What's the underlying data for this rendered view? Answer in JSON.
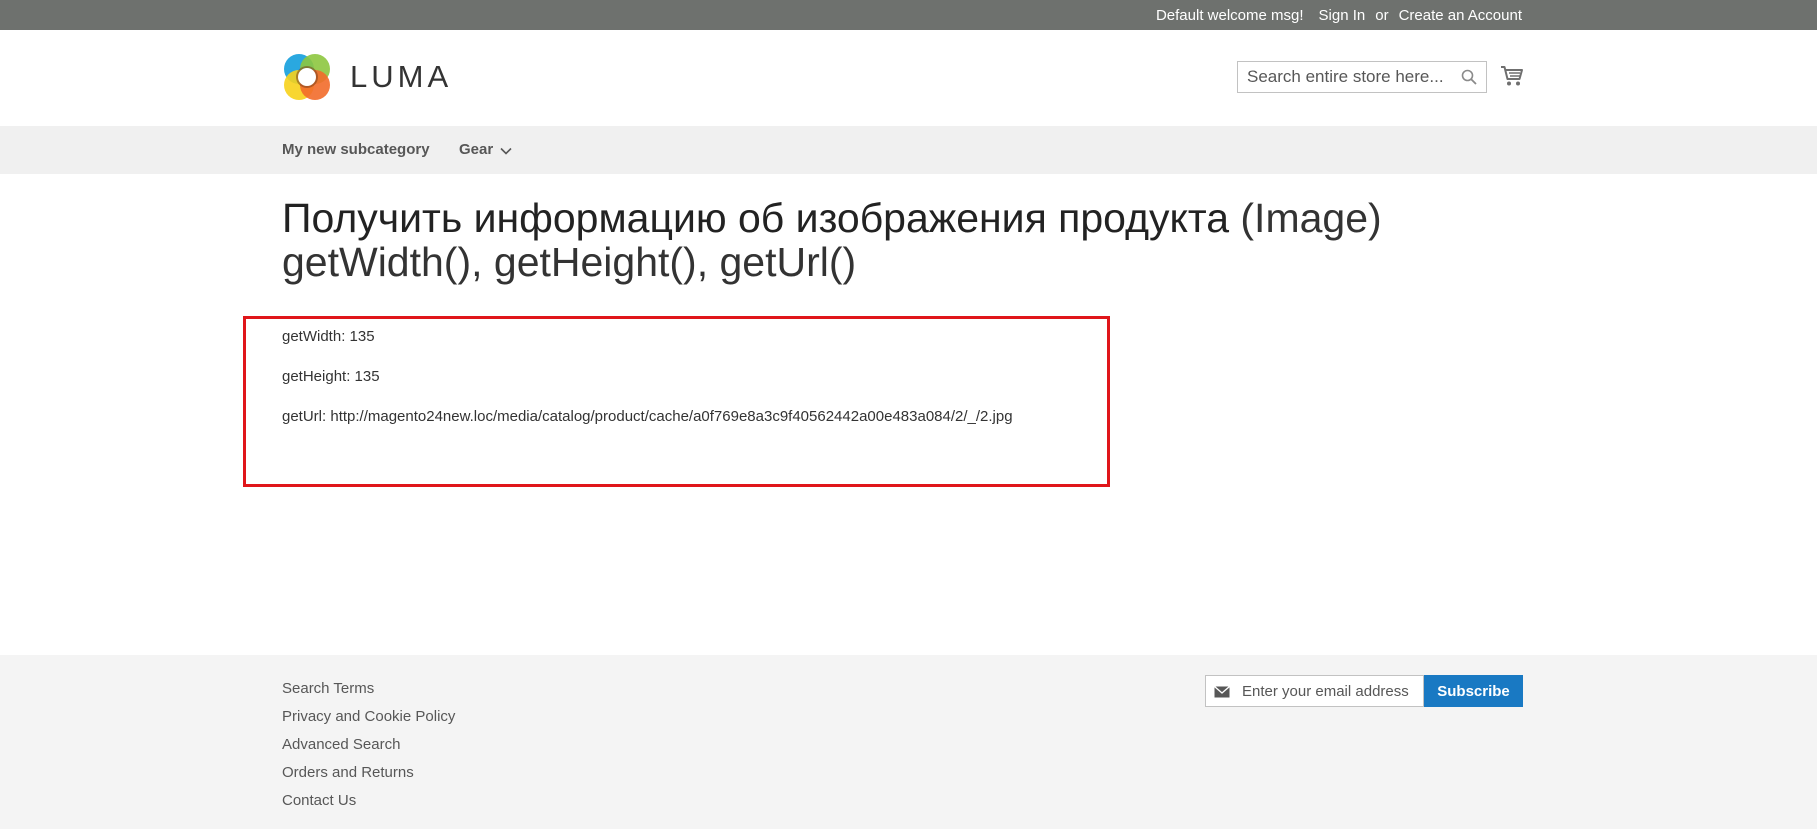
{
  "topbar": {
    "welcome": "Default welcome msg!",
    "sign_in": "Sign In",
    "or": "or",
    "create_account": "Create an Account"
  },
  "header": {
    "logo_text": "LUMA",
    "search_placeholder": "Search entire store here...",
    "icons": [
      "search-icon",
      "cart-icon"
    ]
  },
  "nav": {
    "items": [
      {
        "label": "My new subcategory"
      },
      {
        "label": "Gear",
        "icon": "chevron-down-icon"
      }
    ]
  },
  "main": {
    "title_strong": "Получить информацию об изображения продукта",
    "title_light_1": " (Image)",
    "title_light_2": "getWidth(), getHeight(), getUrl()",
    "info": {
      "width": "getWidth: 135",
      "height": "getHeight: 135",
      "url": "getUrl: http://magento24new.loc/media/catalog/product/cache/a0f769e8a3c9f40562442a00e483a084/2/_/2.jpg"
    },
    "highlight_color": "#e0161a"
  },
  "footer": {
    "links": [
      "Search Terms",
      "Privacy and Cookie Policy",
      "Advanced Search",
      "Orders and Returns",
      "Contact Us"
    ],
    "newsletter_placeholder": "Enter your email address",
    "subscribe_label": "Subscribe",
    "accent_color": "#1979c3"
  }
}
